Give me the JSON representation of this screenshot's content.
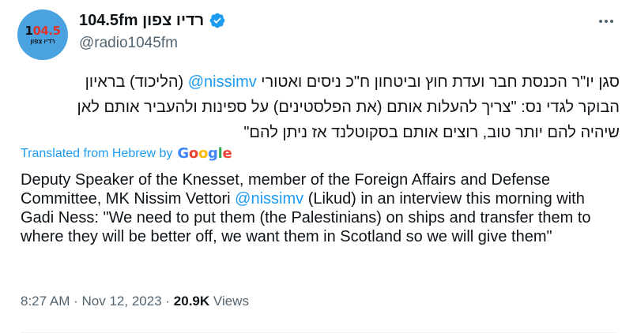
{
  "author": {
    "display_name": "104.5fm רדיו צפון",
    "handle": "@radio1045fm",
    "avatar_text_main_a": "1",
    "avatar_text_main_b": "04.5",
    "avatar_text_sub": "רדיו צפון",
    "verified": true
  },
  "tweet": {
    "hebrew_line1_before": "סגן יו\"ר הכנסת חבר ועדת חוץ וביטחון ח\"כ ניסים ואטורי ",
    "hebrew_mention": "@nissimv",
    "hebrew_line1_after": " (הליכוד) בראיון",
    "hebrew_line2": "הבוקר לגדי נס: \"צריך להעלות אותם (את הפלסטינים) על ספינות ולהעביר אותם לאן",
    "hebrew_line3": "שיהיה להם יותר טוב, רוצים אותם בסקוטלנד אז ניתן להם\"",
    "translated_label": "Translated from Hebrew by",
    "google_letters": [
      "G",
      "o",
      "o",
      "g",
      "l",
      "e"
    ],
    "english_before": "Deputy Speaker of the Knesset, member of the Foreign Affairs and Defense Committee, MK Nissim Vettori ",
    "english_mention": "@nissimv",
    "english_after": " (Likud) in an interview this morning with Gadi Ness: \"We need to put them (the Palestinians) on ships and transfer them to where they will be better off, we want them in Scotland so we will give them\""
  },
  "meta": {
    "time": "8:27 AM",
    "separator": "·",
    "date": "Nov 12, 2023",
    "views_count": "20.9K",
    "views_label": "Views"
  },
  "icons": {
    "more": "more-horizontal-icon",
    "verified": "verified-badge-icon"
  },
  "colors": {
    "link": "#1d9bf0",
    "secondary_text": "#536471",
    "primary_text": "#0f1419",
    "verified": "#1d9bf0",
    "avatar_bg": "#4aa3e0"
  }
}
